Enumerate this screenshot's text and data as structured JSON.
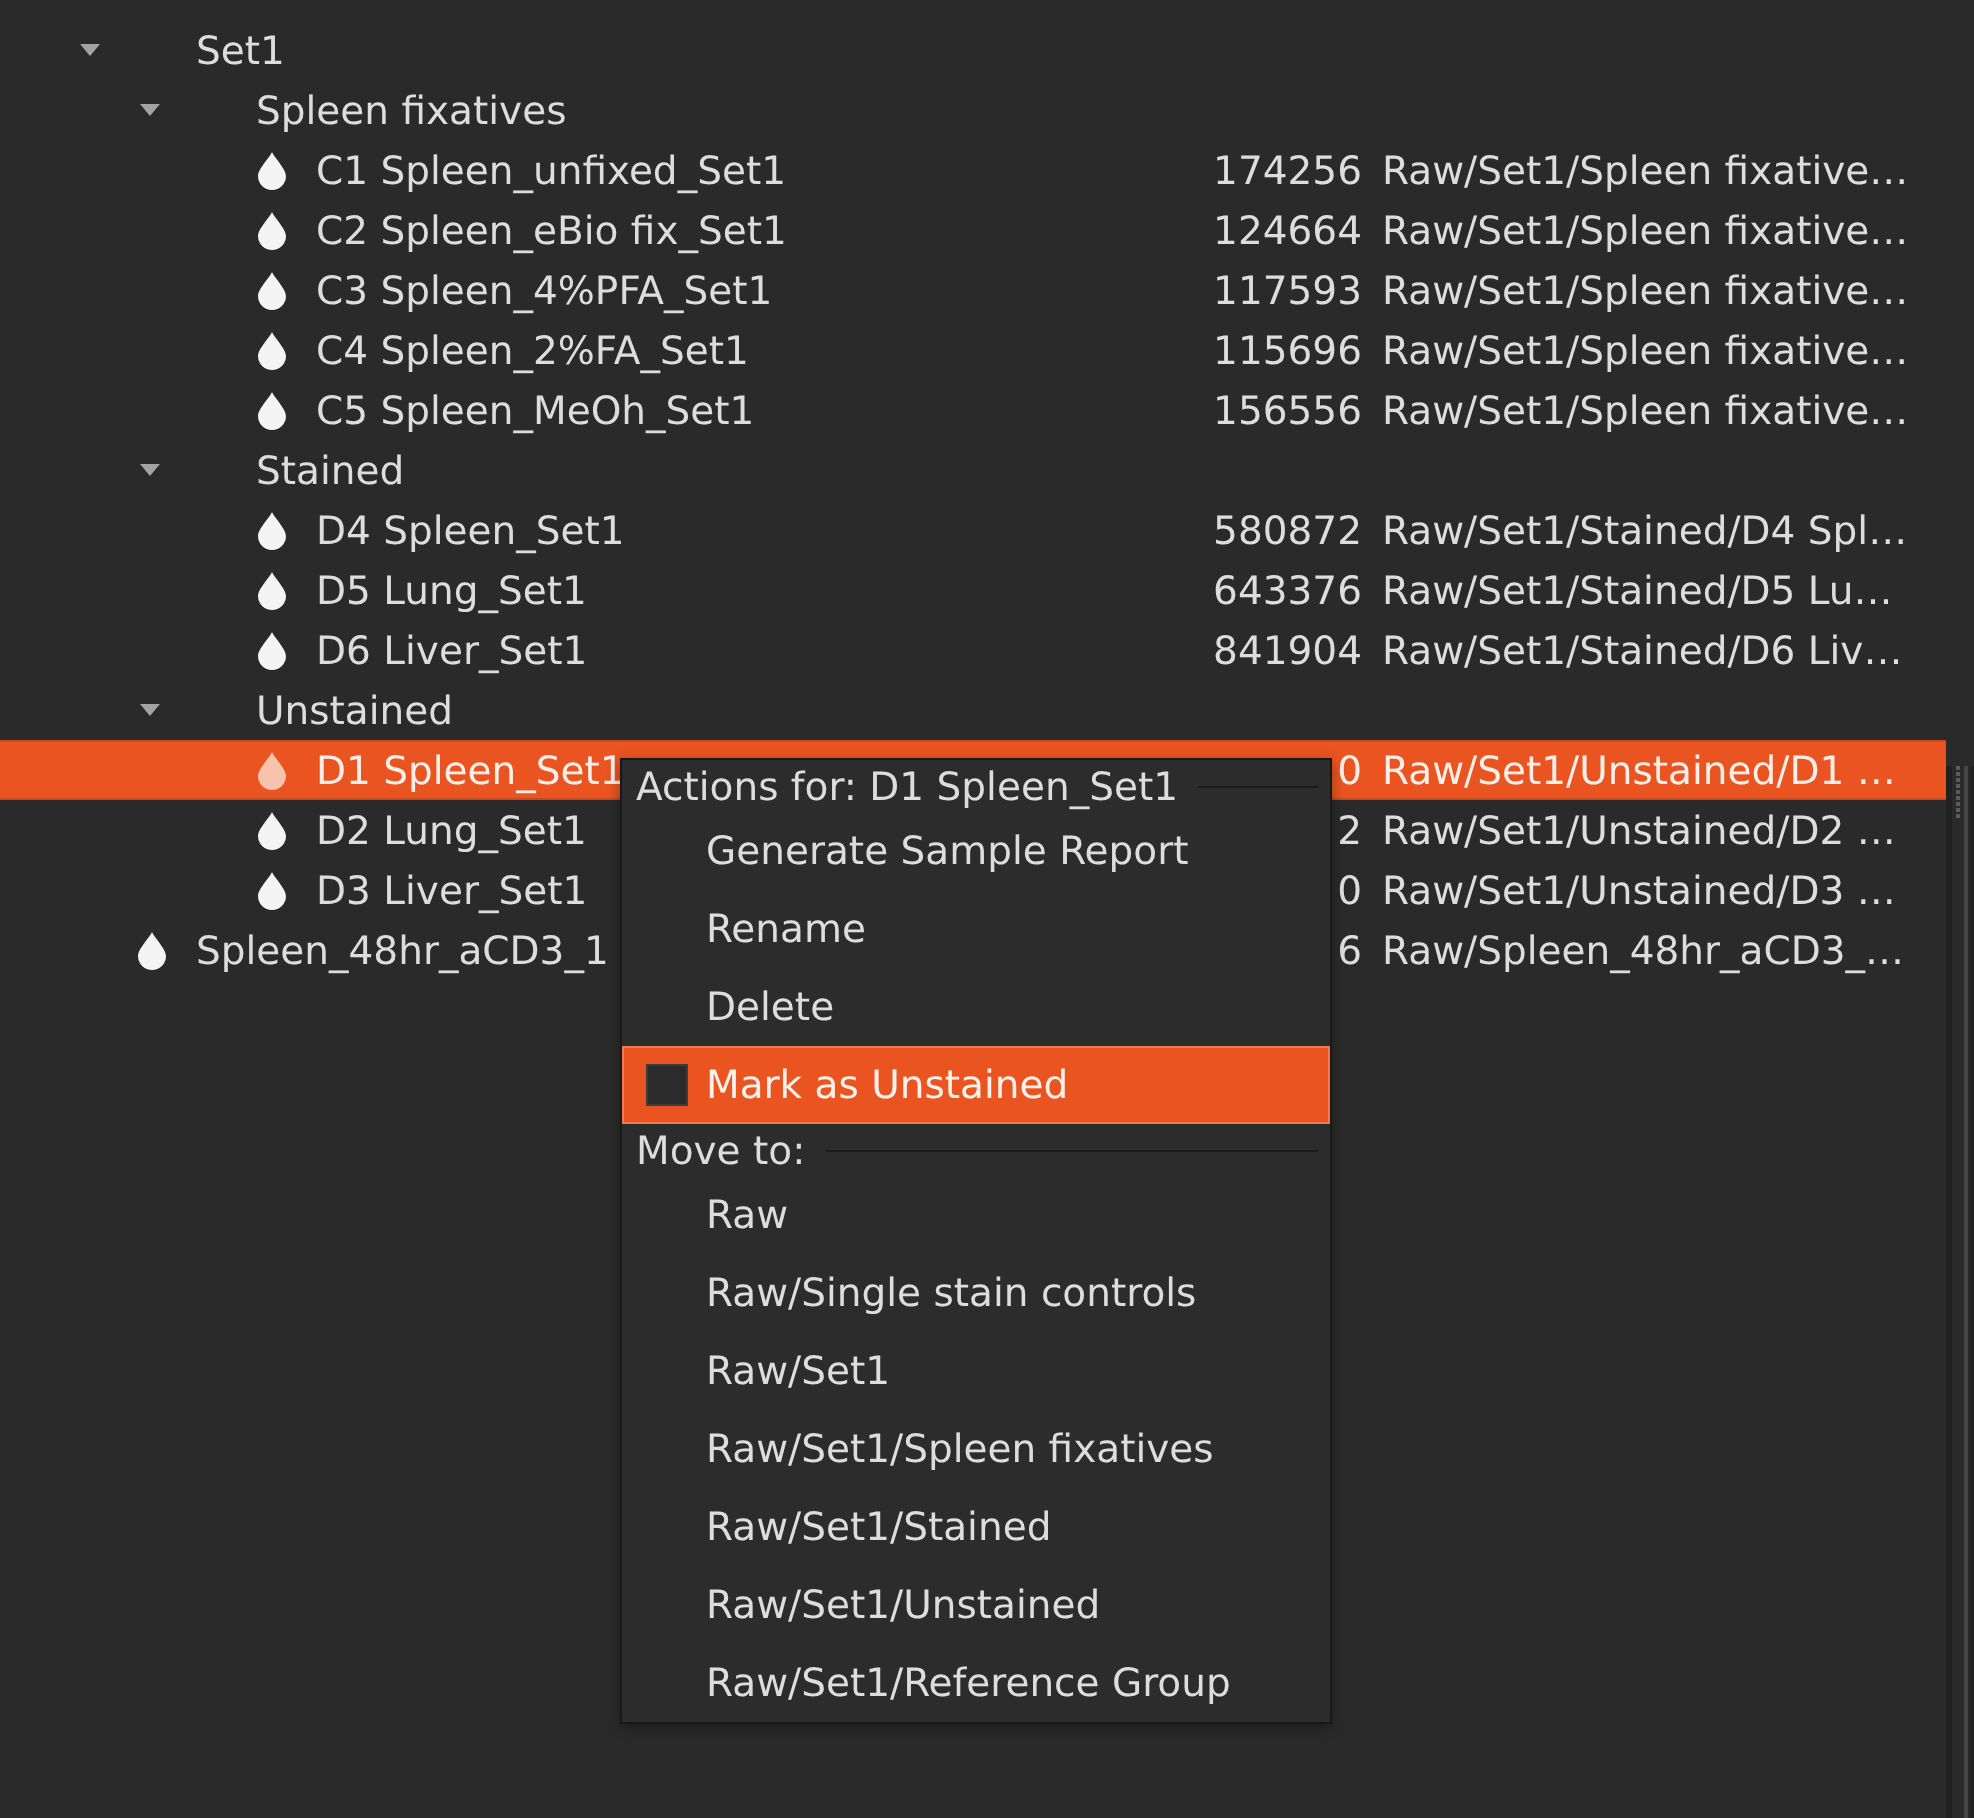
{
  "tree": {
    "items": [
      {
        "kind": "group",
        "name": "Set1",
        "expanded": true,
        "selected": false,
        "children": [
          {
            "kind": "group",
            "name": "Spleen fixatives",
            "expanded": true,
            "selected": false,
            "children": [
              {
                "kind": "sample",
                "name": "C1 Spleen_unfixed_Set1",
                "count": "174256",
                "path": "Raw/Set1/Spleen fixative…",
                "selected": false
              },
              {
                "kind": "sample",
                "name": "C2 Spleen_eBio fix_Set1",
                "count": "124664",
                "path": "Raw/Set1/Spleen fixative…",
                "selected": false
              },
              {
                "kind": "sample",
                "name": "C3 Spleen_4%PFA_Set1",
                "count": "117593",
                "path": "Raw/Set1/Spleen fixative…",
                "selected": false
              },
              {
                "kind": "sample",
                "name": "C4 Spleen_2%FA_Set1",
                "count": "115696",
                "path": "Raw/Set1/Spleen fixative…",
                "selected": false
              },
              {
                "kind": "sample",
                "name": "C5 Spleen_MeOh_Set1",
                "count": "156556",
                "path": "Raw/Set1/Spleen fixative…",
                "selected": false
              }
            ]
          },
          {
            "kind": "group",
            "name": "Stained",
            "expanded": true,
            "selected": false,
            "children": [
              {
                "kind": "sample",
                "name": "D4 Spleen_Set1",
                "count": "580872",
                "path": "Raw/Set1/Stained/D4 Spl…",
                "selected": false
              },
              {
                "kind": "sample",
                "name": "D5 Lung_Set1",
                "count": "643376",
                "path": "Raw/Set1/Stained/D5 Lu…",
                "selected": false
              },
              {
                "kind": "sample",
                "name": "D6 Liver_Set1",
                "count": "841904",
                "path": "Raw/Set1/Stained/D6 Liv…",
                "selected": false
              }
            ]
          },
          {
            "kind": "group",
            "name": "Unstained",
            "expanded": true,
            "selected": false,
            "children": [
              {
                "kind": "sample",
                "name": "D1 Spleen_Set1",
                "count": "0",
                "path": "Raw/Set1/Unstained/D1 …",
                "selected": true
              },
              {
                "kind": "sample",
                "name": "D2 Lung_Set1",
                "count": "2",
                "path": "Raw/Set1/Unstained/D2 …",
                "selected": false
              },
              {
                "kind": "sample",
                "name": "D3 Liver_Set1",
                "count": "0",
                "path": "Raw/Set1/Unstained/D3 …",
                "selected": false
              }
            ]
          }
        ]
      },
      {
        "kind": "sample",
        "name": "Spleen_48hr_aCD3_1",
        "count": "6",
        "path": "Raw/Spleen_48hr_aCD3_…",
        "selected": false
      }
    ]
  },
  "context_menu": {
    "sections": [
      {
        "title": "Actions for: D1 Spleen_Set1",
        "items": [
          {
            "kind": "action",
            "label": "Generate Sample Report",
            "highlighted": false
          },
          {
            "kind": "action",
            "label": "Rename",
            "highlighted": false
          },
          {
            "kind": "action",
            "label": "Delete",
            "highlighted": false
          },
          {
            "kind": "checkbox",
            "label": "Mark as Unstained",
            "checked": false,
            "highlighted": true
          }
        ]
      },
      {
        "title": "Move to:",
        "items": [
          {
            "kind": "action",
            "label": "Raw",
            "highlighted": false
          },
          {
            "kind": "action",
            "label": "Raw/Single stain controls",
            "highlighted": false
          },
          {
            "kind": "action",
            "label": "Raw/Set1",
            "highlighted": false
          },
          {
            "kind": "action",
            "label": "Raw/Set1/Spleen fixatives",
            "highlighted": false
          },
          {
            "kind": "action",
            "label": "Raw/Set1/Stained",
            "highlighted": false
          },
          {
            "kind": "action",
            "label": "Raw/Set1/Unstained",
            "highlighted": false
          },
          {
            "kind": "action",
            "label": "Raw/Set1/Reference Group",
            "highlighted": false
          }
        ]
      }
    ]
  }
}
